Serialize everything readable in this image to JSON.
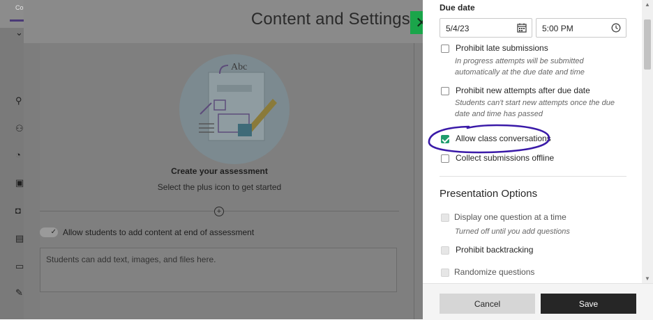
{
  "app": {
    "tab_label": "Co"
  },
  "background": {
    "title": "Content and Settings",
    "create_heading": "Create your assessment",
    "create_subtext": "Select the plus icon to get started",
    "illustration_text": "Abc",
    "toggle_label": "Allow students to add content at end of assessment",
    "textarea_placeholder": "Students can add text, images, and files here."
  },
  "settings": {
    "due_date_label": "Due date",
    "date_value": "5/4/23",
    "time_value": "5:00 PM",
    "options": [
      {
        "label": "Prohibit late submissions",
        "checked": false,
        "help": "In progress attempts will be submitted automatically at the due date and time"
      },
      {
        "label": "Prohibit new attempts after due date",
        "checked": false,
        "help": "Students can't start new attempts once the due date and time has passed"
      },
      {
        "label": "Allow class conversations",
        "checked": true
      },
      {
        "label": "Collect submissions offline",
        "checked": false
      }
    ],
    "presentation_heading": "Presentation Options",
    "presentation_options": [
      {
        "label": "Display one question at a time",
        "disabled": true,
        "help": "Turned off until you add questions"
      },
      {
        "label": "Prohibit backtracking",
        "disabled": true
      },
      {
        "label": "Randomize questions",
        "disabled": true
      }
    ]
  },
  "footer": {
    "cancel_label": "Cancel",
    "save_label": "Save"
  },
  "colors": {
    "accent": "#1aa54a",
    "check": "#1f9c6d",
    "annotation": "#3a1aa8",
    "primary_button": "#262626"
  }
}
